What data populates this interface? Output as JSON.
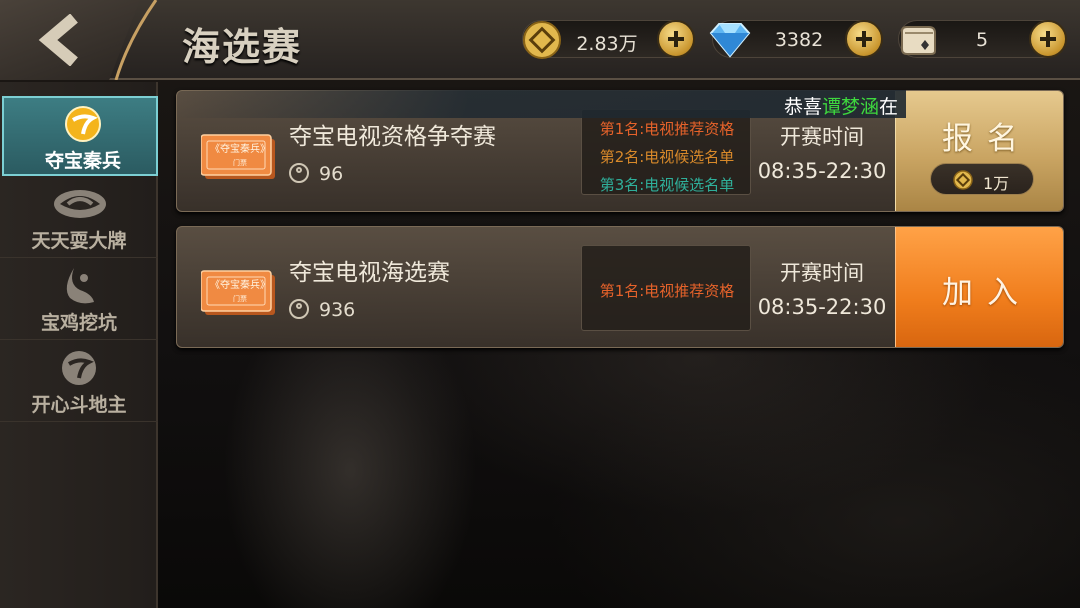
{
  "header": {
    "title": "海选赛",
    "coins": "2.83万",
    "diamonds": "3382",
    "cards": "5"
  },
  "sidebar": {
    "items": [
      {
        "label": "夺宝秦兵",
        "active": true
      },
      {
        "label": "天天耍大牌",
        "active": false
      },
      {
        "label": "宝鸡挖坑",
        "active": false
      },
      {
        "label": "开心斗地主",
        "active": false
      }
    ]
  },
  "marquee": {
    "prefix": "恭喜",
    "name": "谭梦涵",
    "suffix": "在"
  },
  "cards": [
    {
      "ticket_text": "《夺宝秦兵》",
      "ticket_sub": "门票",
      "title": "夺宝电视资格争夺赛",
      "players": "96",
      "prizes": [
        {
          "text": "第1名:电视推荐资格",
          "color": "#e5622a"
        },
        {
          "text": "第2名:电视候选名单",
          "color": "#d8892a"
        },
        {
          "text": "第3名:电视候选名单",
          "color": "#2faf9a"
        }
      ],
      "time_label": "开赛时间",
      "time_value": "08:35-22:30",
      "button_label": "报名",
      "fee": "1万"
    },
    {
      "ticket_text": "《夺宝秦兵》",
      "ticket_sub": "门票",
      "title": "夺宝电视海选赛",
      "players": "936",
      "prizes": [
        {
          "text": "第1名:电视推荐资格",
          "color": "#e5622a"
        }
      ],
      "time_label": "开赛时间",
      "time_value": "08:35-22:30",
      "button_label": "加入"
    }
  ],
  "colors": {
    "accent_gold": "#c9a462",
    "accent_orange": "#f07d1c",
    "active_tab": "#3d7d83"
  }
}
